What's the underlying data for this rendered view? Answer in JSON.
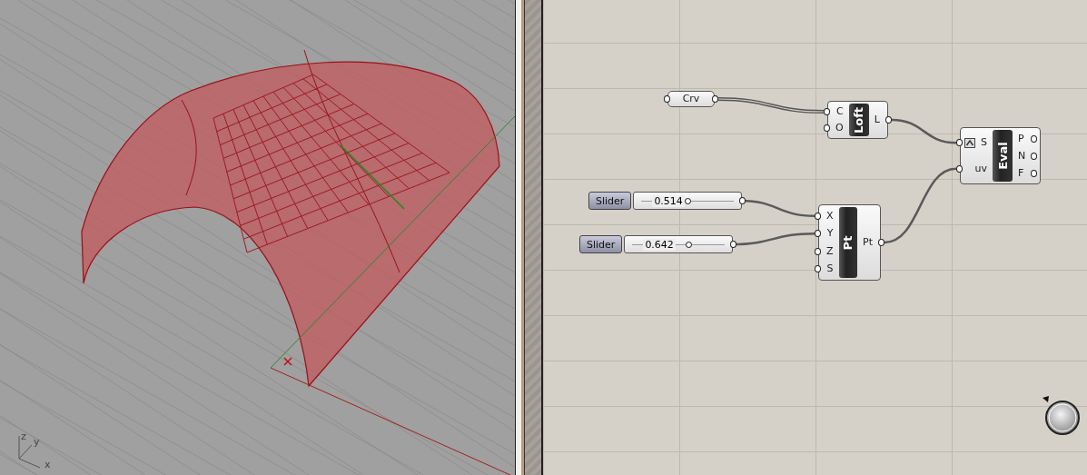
{
  "viewport": {
    "axes": {
      "x": "x",
      "y": "y",
      "z": "z"
    }
  },
  "canvas": {
    "components": [
      {
        "kind": "param",
        "name": "Crv"
      },
      {
        "kind": "component",
        "name": "Loft",
        "inputs": [
          {
            "label": "C",
            "reparameterized": false
          },
          {
            "label": "O",
            "reparameterized": false
          }
        ],
        "outputs": [
          "L"
        ]
      },
      {
        "kind": "component",
        "name": "Eval",
        "inputs": [
          {
            "label": "S",
            "reparameterized": true
          },
          {
            "label": "uv",
            "reparameterized": false
          }
        ],
        "outputs": [
          "P",
          "N",
          "F"
        ]
      },
      {
        "kind": "slider",
        "name": "Slider",
        "value": "0.514",
        "level": 0.514
      },
      {
        "kind": "slider",
        "name": "Slider",
        "value": "0.642",
        "level": 0.642
      },
      {
        "kind": "component",
        "name": "Pt",
        "inputs": [
          {
            "label": "X",
            "reparameterized": false
          },
          {
            "label": "Y",
            "reparameterized": false
          },
          {
            "label": "Z",
            "reparameterized": false
          },
          {
            "label": "S",
            "reparameterized": false
          }
        ],
        "outputs": [
          "Pt"
        ]
      }
    ]
  }
}
